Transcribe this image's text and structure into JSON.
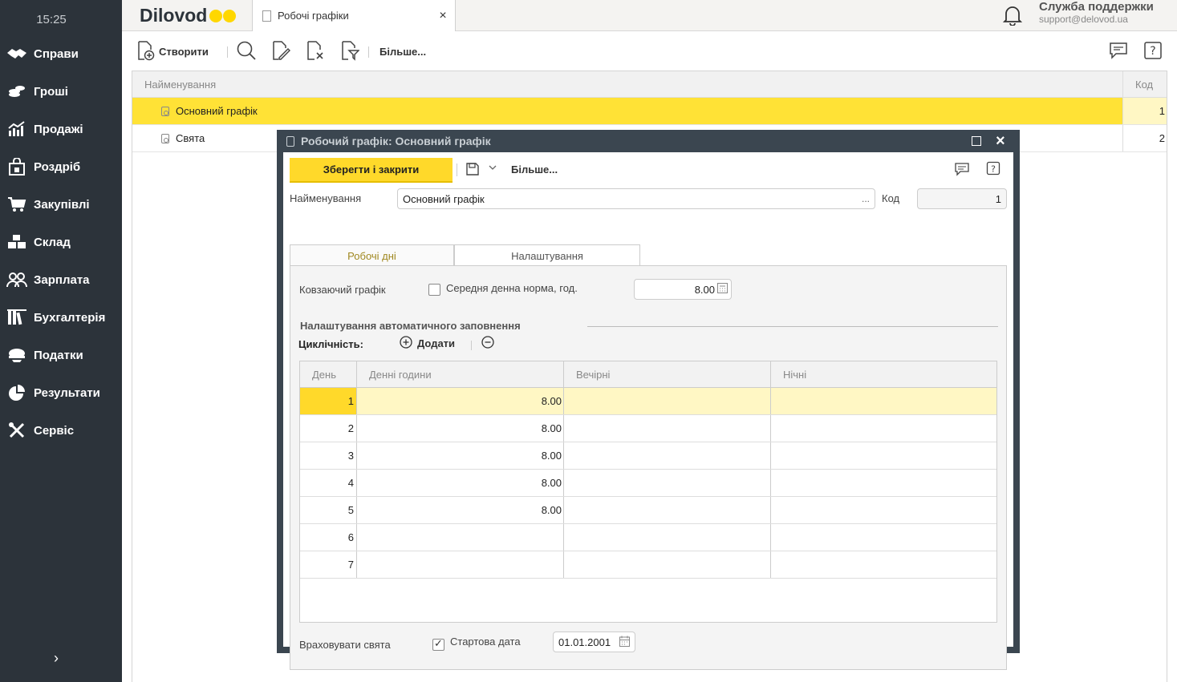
{
  "sidebar": {
    "clock": "15:25",
    "items": [
      {
        "label": "Справи",
        "icon": "handshake-icon"
      },
      {
        "label": "Гроші",
        "icon": "coins-icon"
      },
      {
        "label": "Продажі",
        "icon": "chart-icon"
      },
      {
        "label": "Роздріб",
        "icon": "shop-bag-icon"
      },
      {
        "label": "Закупівлі",
        "icon": "cart-icon"
      },
      {
        "label": "Склад",
        "icon": "boxes-icon"
      },
      {
        "label": "Зарплата",
        "icon": "people-icon"
      },
      {
        "label": "Бухгалтерія",
        "icon": "books-icon"
      },
      {
        "label": "Податки",
        "icon": "cap-icon"
      },
      {
        "label": "Результати",
        "icon": "pie-icon"
      },
      {
        "label": "Сервіс",
        "icon": "tools-icon"
      }
    ],
    "expand": "›"
  },
  "header": {
    "logo": "Dilovod",
    "tab_title": "Робочі графіки",
    "tab_close": "×",
    "support_title": "Служба поддержки",
    "support_email": "support@delovod.ua"
  },
  "toolbar": {
    "create_label": "Створити",
    "more_label": "Більше..."
  },
  "list": {
    "col_name": "Найменування",
    "col_code": "Код",
    "rows": [
      {
        "name": "Основний графік",
        "code": "1"
      },
      {
        "name": "Свята",
        "code": "2"
      }
    ]
  },
  "dialog": {
    "title": "Робочий графік: Основний графік",
    "close": "×",
    "save_close_label": "Зберегти і закрити",
    "more_label": "Більше...",
    "name_label": "Найменування",
    "name_value": "Основний графік",
    "name_ellipsis": "...",
    "code_label": "Код",
    "code_value": "1",
    "tab_workdays": "Робочі дні",
    "tab_settings": "Налаштування",
    "sliding_label": "Ковзаючий графік",
    "avg_norm_label": "Середня денна норма, год.",
    "avg_norm_value": "8.00",
    "autofill_section": "Налаштування автоматичного заповнення",
    "cyclicity_label": "Циклічність:",
    "add_label": "Додати",
    "grid": {
      "col_day": "День",
      "col_day_hours": "Денні години",
      "col_evening": "Вечірні",
      "col_night": "Нічні",
      "rows": [
        {
          "day": "1",
          "day_hours": "8.00",
          "evening": "",
          "night": ""
        },
        {
          "day": "2",
          "day_hours": "8.00",
          "evening": "",
          "night": ""
        },
        {
          "day": "3",
          "day_hours": "8.00",
          "evening": "",
          "night": ""
        },
        {
          "day": "4",
          "day_hours": "8.00",
          "evening": "",
          "night": ""
        },
        {
          "day": "5",
          "day_hours": "8.00",
          "evening": "",
          "night": ""
        },
        {
          "day": "6",
          "day_hours": "",
          "evening": "",
          "night": ""
        },
        {
          "day": "7",
          "day_hours": "",
          "evening": "",
          "night": ""
        }
      ]
    },
    "holidays_label": "Враховувати свята",
    "start_date_label": "Стартова дата",
    "start_date_value": "01.01.2001"
  },
  "colors": {
    "sidebar_bg": "#2c333a",
    "accent_yellow": "#ffd92a",
    "selected_row": "#ffe236",
    "dialog_frame": "#3b4650"
  }
}
